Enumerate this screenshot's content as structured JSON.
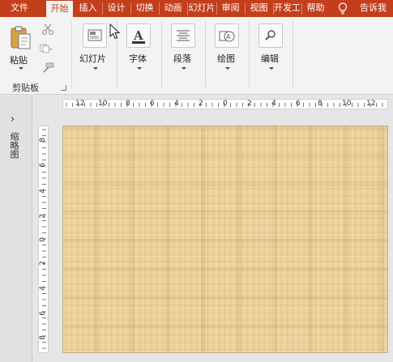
{
  "tabs": [
    {
      "label": "文件",
      "active": false
    },
    {
      "label": "开始",
      "active": true
    },
    {
      "label": "插入",
      "active": false
    },
    {
      "label": "设计",
      "active": false
    },
    {
      "label": "切换",
      "active": false
    },
    {
      "label": "动画",
      "active": false
    },
    {
      "label": "幻灯片",
      "active": false
    },
    {
      "label": "审阅",
      "active": false
    },
    {
      "label": "视图",
      "active": false
    },
    {
      "label": "开发工",
      "active": false
    },
    {
      "label": "帮助",
      "active": false
    }
  ],
  "tell_me": "告诉我",
  "ribbon": {
    "clipboard": {
      "paste": "粘贴",
      "group": "剪贴板"
    },
    "slides": {
      "label": "幻灯片"
    },
    "font": {
      "label": "字体"
    },
    "paragraph": {
      "label": "段落"
    },
    "drawing": {
      "label": "绘图"
    },
    "editing": {
      "label": "编辑"
    }
  },
  "thumbnail_pane": {
    "label": "缩略图"
  },
  "ruler": {
    "horizontal": [
      "12",
      "10",
      "8",
      "6",
      "4",
      "2",
      "0",
      "2",
      "4",
      "6",
      "8",
      "10",
      "12"
    ],
    "vertical": [
      "8",
      "6",
      "4",
      "2",
      "0",
      "2",
      "4",
      "6",
      "8"
    ]
  },
  "colors": {
    "accent": "#c43e1c",
    "slide_bg": "#ecd39a"
  }
}
